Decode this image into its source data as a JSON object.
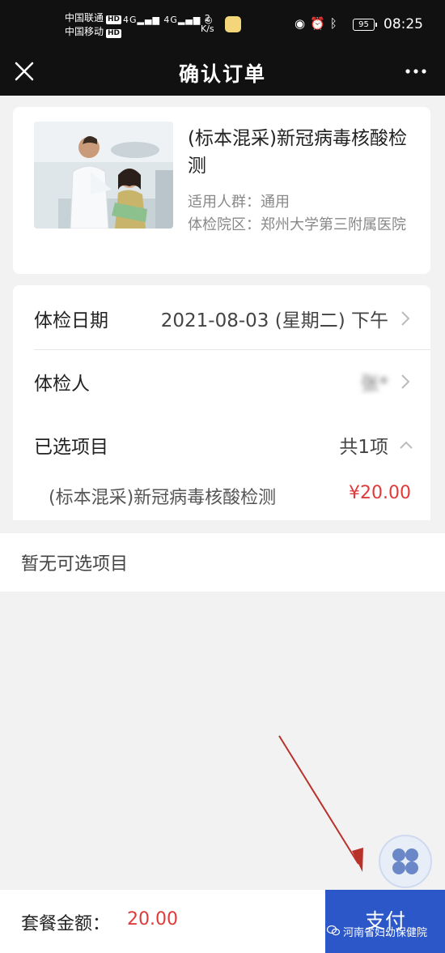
{
  "status_bar": {
    "carrier1": "中国联通",
    "carrier2": "中国移动",
    "hd": "HD",
    "net_label": "4G",
    "speed_value": "2",
    "speed_unit": "K/s",
    "battery": "95",
    "time": "08:25"
  },
  "nav": {
    "title": "确认订单",
    "close_icon": "close-icon",
    "more_icon": "more-icon"
  },
  "product": {
    "title": "(标本混采)新冠病毒核酸检测",
    "audience_label": "适用人群：",
    "audience_value": "通用",
    "hospital_label": "体检院区：",
    "hospital_value": "郑州大学第三附属医院"
  },
  "details": {
    "date_label": "体检日期",
    "date_value": "2021-08-03 (星期二) 下午",
    "person_label": "体检人",
    "person_value": "张*",
    "selected_label": "已选项目",
    "selected_count": "共1项",
    "items": [
      {
        "name": "(标本混采)新冠病毒核酸检测",
        "price": "¥20.00"
      }
    ]
  },
  "empty": {
    "text": "暂无可选项目"
  },
  "bottom": {
    "total_label": "套餐金额：",
    "total_amount": "20.00",
    "pay_label": "支付"
  },
  "watermark": "河南省妇幼保健院",
  "colors": {
    "accent": "#2c57c9",
    "price": "#e03a3a",
    "header": "#111111"
  }
}
